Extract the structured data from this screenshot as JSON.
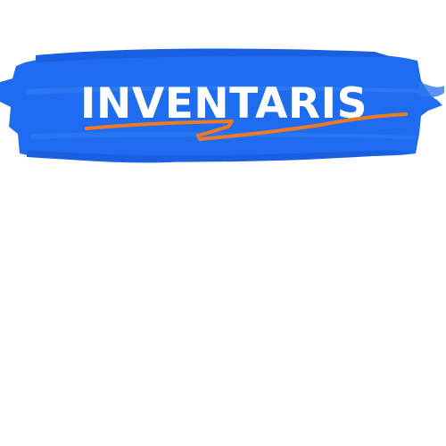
{
  "banner": {
    "title": "INVENTARIS",
    "brush_color": "#1E6CF0",
    "brush_shade": "#1A5FE0",
    "text_color": "#FFFFFF",
    "underline_color": "#F07A24"
  }
}
